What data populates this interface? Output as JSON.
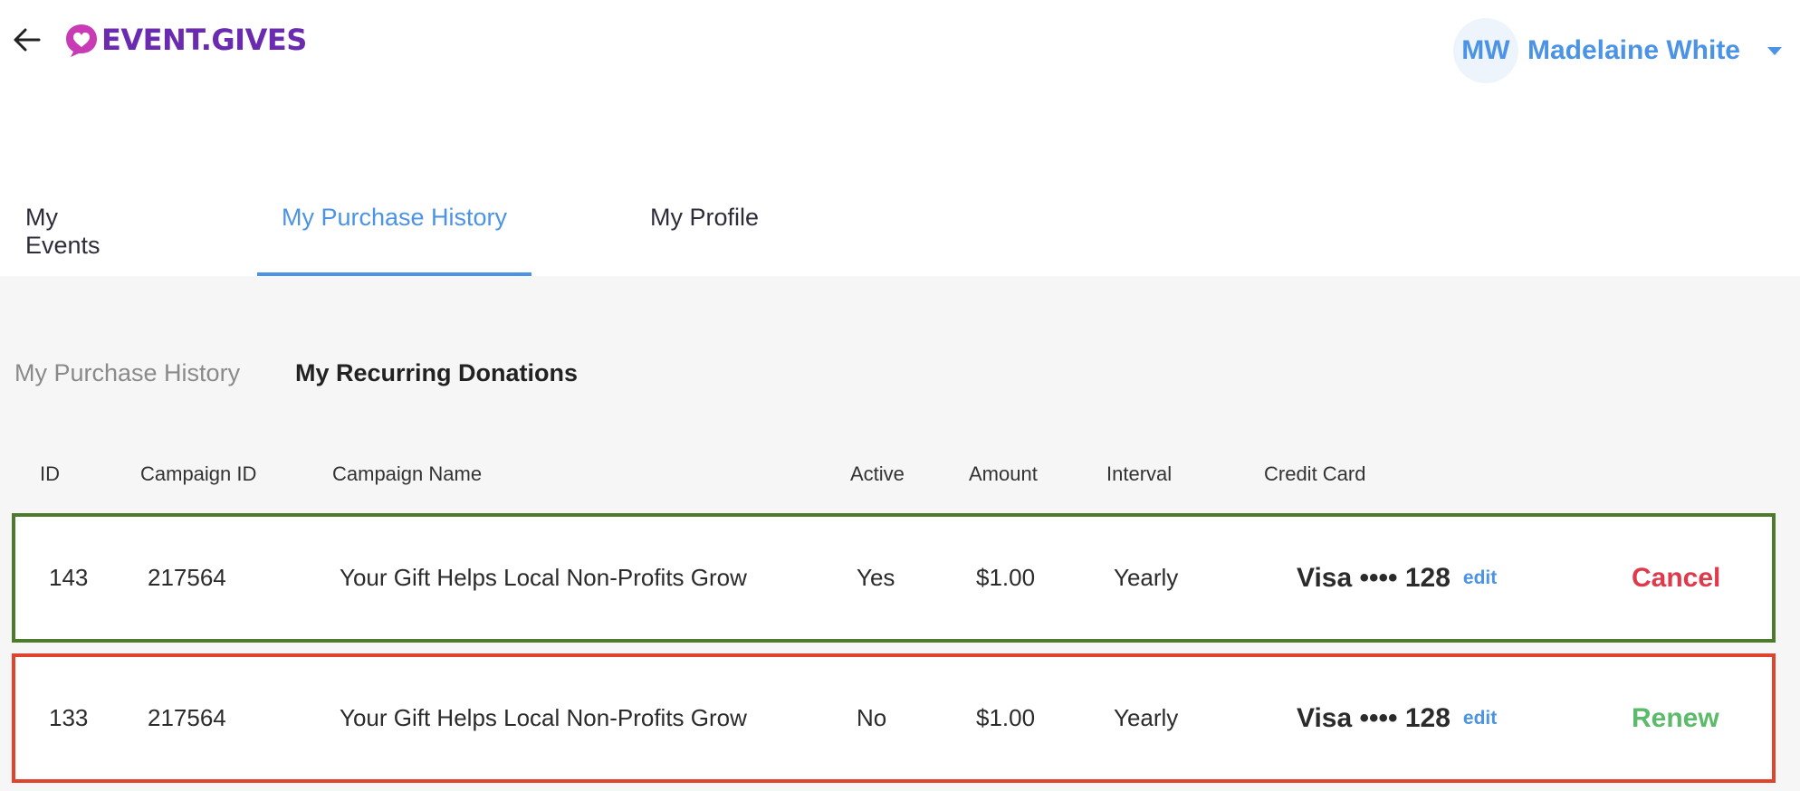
{
  "header": {
    "logo_text": "EVENT.GIVES",
    "user_initials": "MW",
    "user_name": "Madelaine White"
  },
  "main_tabs": [
    {
      "label": "My Events"
    },
    {
      "label": "My Purchase History",
      "active": true
    },
    {
      "label": "My Profile"
    }
  ],
  "sub_tabs": [
    {
      "label": "My Purchase History"
    },
    {
      "label": "My Recurring Donations",
      "active": true
    }
  ],
  "table": {
    "columns": [
      "ID",
      "Campaign ID",
      "Campaign Name",
      "Active",
      "Amount",
      "Interval",
      "Credit Card"
    ],
    "rows": [
      {
        "id": "143",
        "campaign_id": "217564",
        "campaign_name": "Your Gift Helps Local Non-Profits Grow",
        "active": "Yes",
        "amount": "$1.00",
        "interval": "Yearly",
        "credit_card": "Visa •••• 128",
        "edit_label": "edit",
        "action_label": "Cancel"
      },
      {
        "id": "133",
        "campaign_id": "217564",
        "campaign_name": "Your Gift Helps Local Non-Profits Grow",
        "active": "No",
        "amount": "$1.00",
        "interval": "Yearly",
        "credit_card": "Visa •••• 128",
        "edit_label": "edit",
        "action_label": "Renew"
      }
    ]
  },
  "colors": {
    "accent": "#4a93e6",
    "brand": "#6a2bb0",
    "logo_mark": "#c83bb5",
    "row_active_border": "#4e7a2e",
    "row_inactive_border": "#e0442c",
    "cancel": "#e0394b",
    "renew": "#5cba6b"
  },
  "icons": {
    "back": "arrow-left-icon",
    "logo": "heart-bubble-icon",
    "dropdown": "caret-down-icon"
  }
}
